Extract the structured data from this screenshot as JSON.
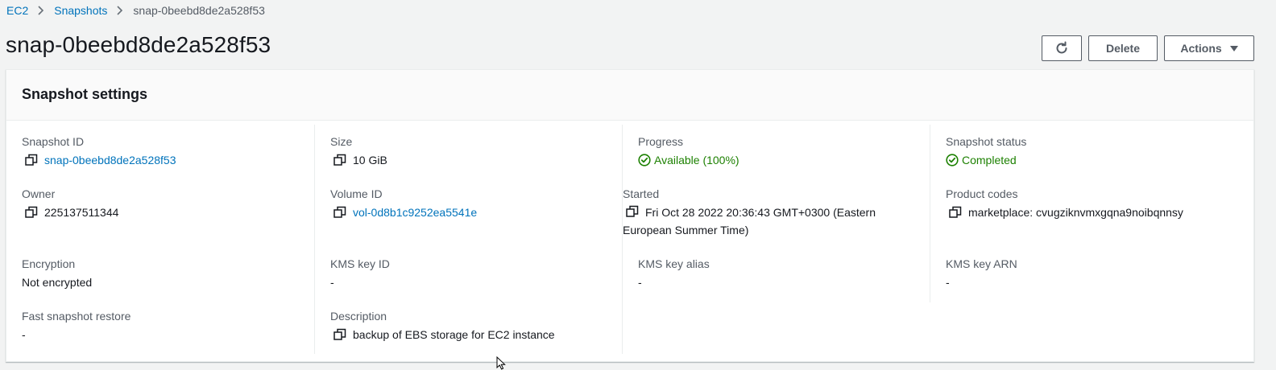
{
  "breadcrumb": {
    "items": [
      "EC2",
      "Snapshots"
    ],
    "current": "snap-0beebd8de2a528f53"
  },
  "title": "snap-0beebd8de2a528f53",
  "buttons": {
    "delete": "Delete",
    "actions": "Actions"
  },
  "panel": {
    "title": "Snapshot settings"
  },
  "fields": {
    "snapshot_id": {
      "label": "Snapshot ID",
      "value": "snap-0beebd8de2a528f53"
    },
    "size": {
      "label": "Size",
      "value": "10 GiB"
    },
    "progress": {
      "label": "Progress",
      "value": "Available (100%)"
    },
    "snapshot_status": {
      "label": "Snapshot status",
      "value": "Completed"
    },
    "owner": {
      "label": "Owner",
      "value": "225137511344"
    },
    "volume_id": {
      "label": "Volume ID",
      "value": "vol-0d8b1c9252ea5541e"
    },
    "started": {
      "label": "Started",
      "value": "Fri Oct 28 2022 20:36:43 GMT+0300 (Eastern European Summer Time)"
    },
    "product_codes": {
      "label": "Product codes",
      "value": "marketplace: cvugziknvmxgqna9noibqnnsy"
    },
    "encryption": {
      "label": "Encryption",
      "value": "Not encrypted"
    },
    "kms_key_id": {
      "label": "KMS key ID",
      "value": "-"
    },
    "kms_key_alias": {
      "label": "KMS key alias",
      "value": "-"
    },
    "kms_key_arn": {
      "label": "KMS key ARN",
      "value": "-"
    },
    "fast_snapshot_restore": {
      "label": "Fast snapshot restore",
      "value": "-"
    },
    "description": {
      "label": "Description",
      "value": "backup of EBS storage for EC2 instance"
    }
  },
  "colors": {
    "link": "#0073bb",
    "success": "#1d8102",
    "text": "#16191f",
    "label": "#545b64",
    "background": "#f2f3f3"
  },
  "icons": {
    "copy": "copy-icon",
    "check": "status-success-icon",
    "refresh": "refresh-icon",
    "caret": "caret-down-icon",
    "chevron": "chevron-right-icon"
  }
}
